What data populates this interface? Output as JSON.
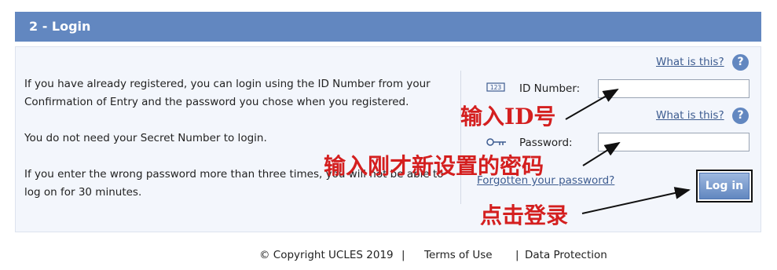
{
  "section": {
    "title": "2 - Login"
  },
  "intro": {
    "p1": "If you have already registered, you can login using the ID Number from your Confirmation of Entry and the password you chose when you registered.",
    "p2": "You do not need your Secret Number to login.",
    "p3": "If you enter the wrong password more than three times, you will not be able to log on for 30 minutes."
  },
  "form": {
    "what_is_this": "What is this?",
    "help_glyph": "?",
    "id_icon_text": "123",
    "id_label": "ID Number:",
    "id_value": "",
    "password_label": "Password:",
    "password_value": "",
    "forgot_link": "Forgotten your password?",
    "login_label": "Log in"
  },
  "annotations": {
    "id": "输入ID号",
    "password": "输入刚才新设置的密码",
    "login": "点击登录",
    "color": "#d41f1f"
  },
  "footer": {
    "copyright": "© Copyright UCLES 2019",
    "sep": "|",
    "terms": "Terms of Use",
    "data_protection": "Data Protection"
  },
  "colors": {
    "header": "#6287c0",
    "panel": "#f3f6fc",
    "link": "#3d5c90"
  }
}
